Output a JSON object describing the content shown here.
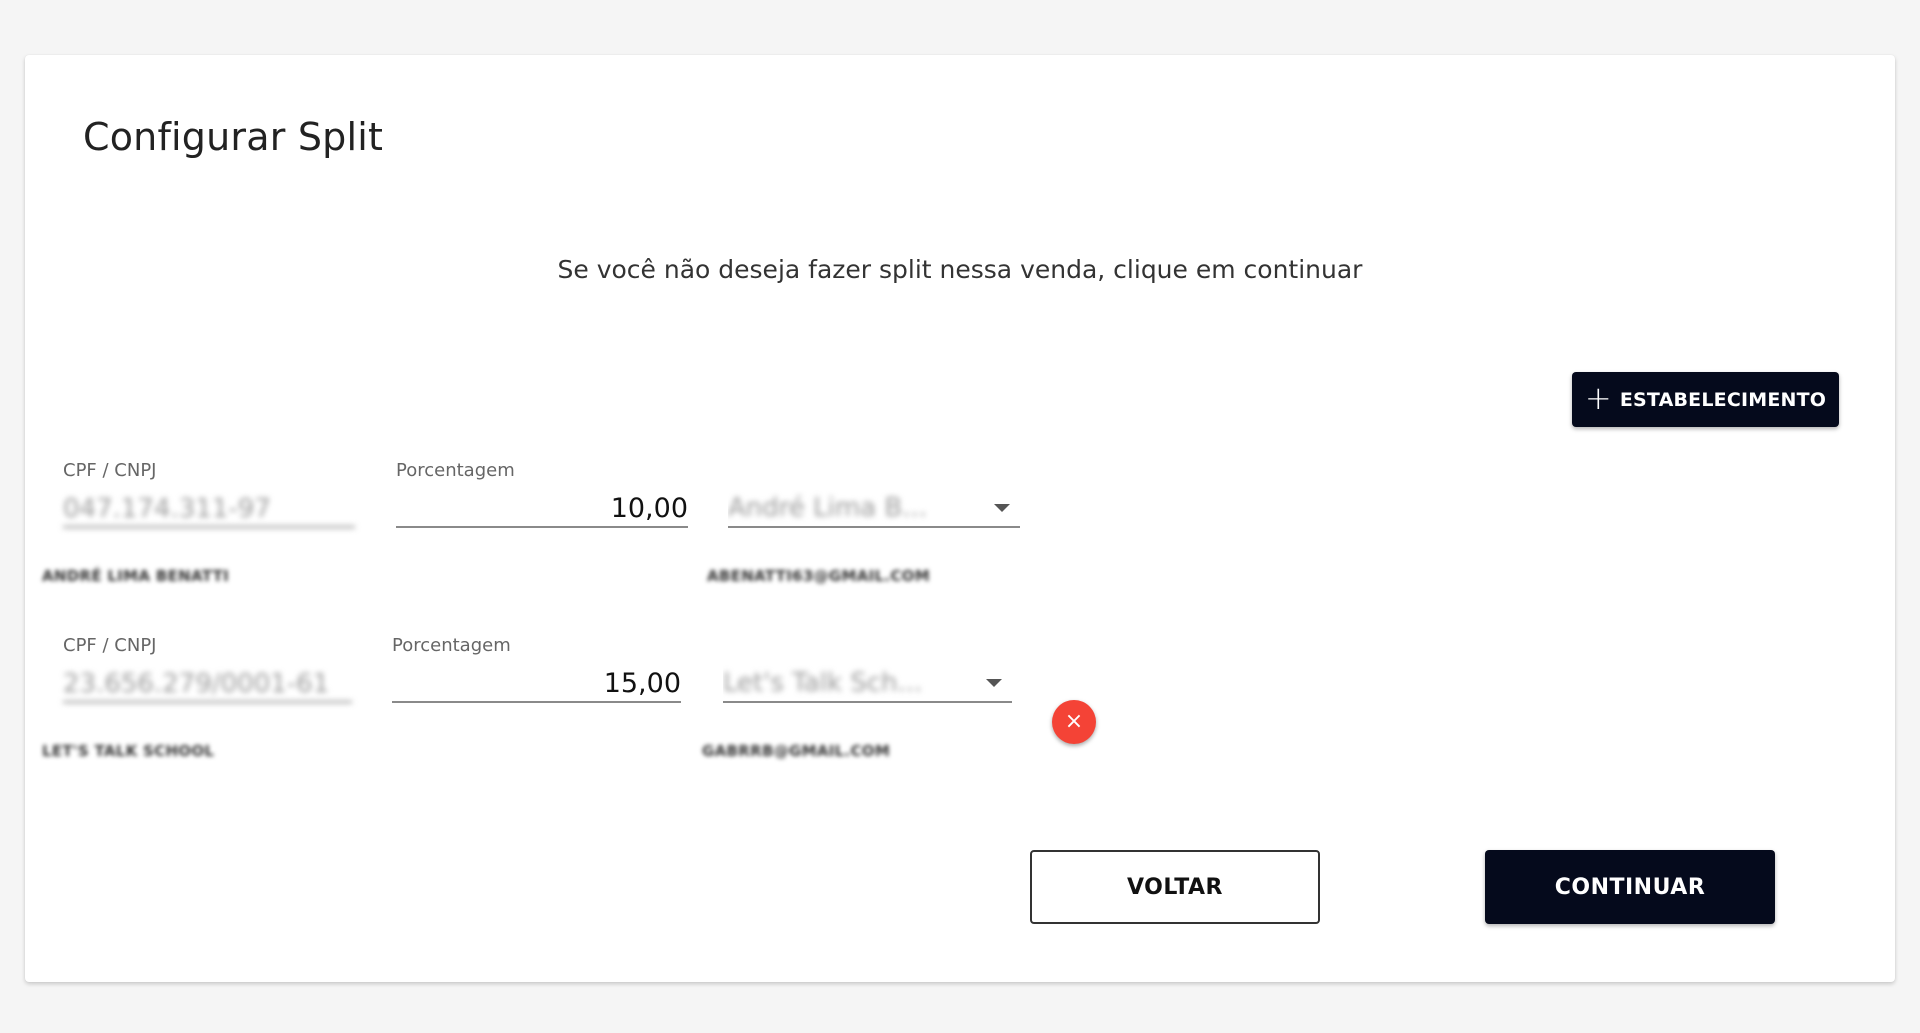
{
  "page": {
    "title": "Configurar Split",
    "subtitle": "Se você não deseja fazer split nessa venda, clique em continuar"
  },
  "actions": {
    "add_establishment": "ESTABELECIMENTO",
    "back": "VOLTAR",
    "continue": "CONTINUAR"
  },
  "icons": {
    "add": "plus-icon",
    "remove": "close-icon",
    "dropdown": "chevron-down-icon"
  },
  "colors": {
    "primary": "#050a1c",
    "danger": "#f44336"
  },
  "splits": [
    {
      "document_label": "CPF / CNPJ",
      "document_value": "047.174.311-97",
      "document_helper": "ANDRÉ LIMA BENATTI",
      "percentage_label": "Porcentagem",
      "percentage_value": "10,00",
      "establishment_value": "André Lima B...",
      "establishment_helper": "ABENATTI63@GMAIL.COM",
      "removable": false
    },
    {
      "document_label": "CPF / CNPJ",
      "document_value": "23.656.279/0001-61",
      "document_helper": "LET'S TALK SCHOOL",
      "percentage_label": "Porcentagem",
      "percentage_value": "15,00",
      "establishment_value": "Let's Talk Sch...",
      "establishment_helper": "GABRRB@GMAIL.COM",
      "removable": true,
      "remove_label": "×"
    }
  ]
}
